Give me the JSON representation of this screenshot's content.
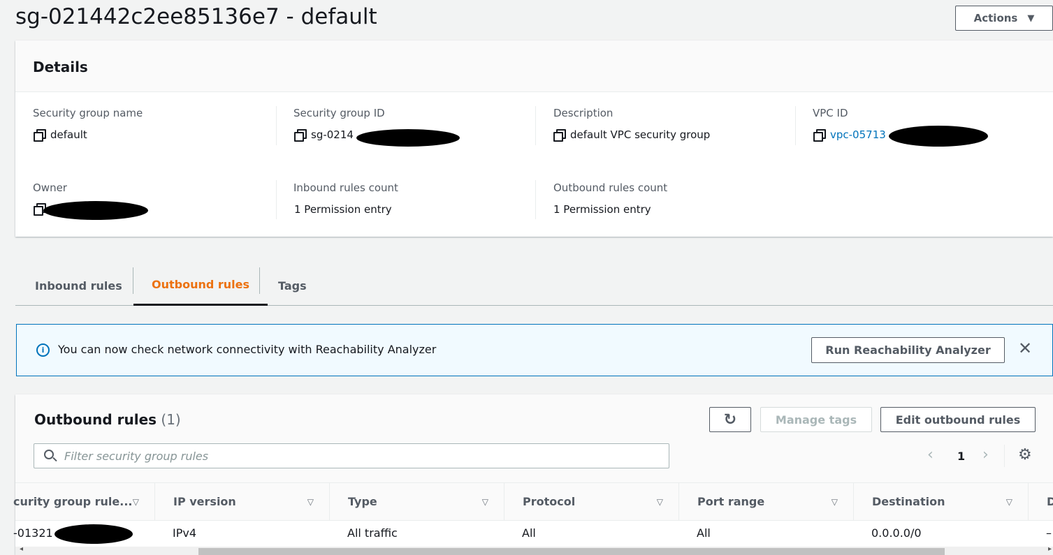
{
  "header": {
    "title": "sg-021442c2ee85136e7 - default",
    "actions_label": "Actions"
  },
  "details": {
    "title": "Details",
    "fields": [
      {
        "label": "Security group name",
        "value": "default"
      },
      {
        "label": "Security group ID",
        "value": "sg-0214"
      },
      {
        "label": "Description",
        "value": "default VPC security group"
      },
      {
        "label": "VPC ID",
        "value": "vpc-05713"
      },
      {
        "label": "Owner",
        "value": ""
      },
      {
        "label": "Inbound rules count",
        "value": "1 Permission entry"
      },
      {
        "label": "Outbound rules count",
        "value": "1 Permission entry"
      }
    ]
  },
  "tabs": [
    {
      "label": "Inbound rules"
    },
    {
      "label": "Outbound rules",
      "active": true
    },
    {
      "label": "Tags"
    }
  ],
  "banner": {
    "text": "You can now check network connectivity with Reachability Analyzer",
    "button": "Run Reachability Analyzer"
  },
  "table": {
    "title": "Outbound rules",
    "count": "(1)",
    "manage_tags": "Manage tags",
    "edit": "Edit outbound rules",
    "filter_placeholder": "Filter security group rules",
    "page": "1",
    "columns": [
      "curity group rule...",
      "IP version",
      "Type",
      "Protocol",
      "Port range",
      "Destination",
      "D"
    ],
    "rows": [
      [
        "-01321",
        "IPv4",
        "All traffic",
        "All",
        "All",
        "0.0.0.0/0",
        "–"
      ]
    ]
  },
  "colors": {
    "accent": "#ec7211",
    "link": "#0073bb",
    "banner_bg": "#f1faff"
  }
}
